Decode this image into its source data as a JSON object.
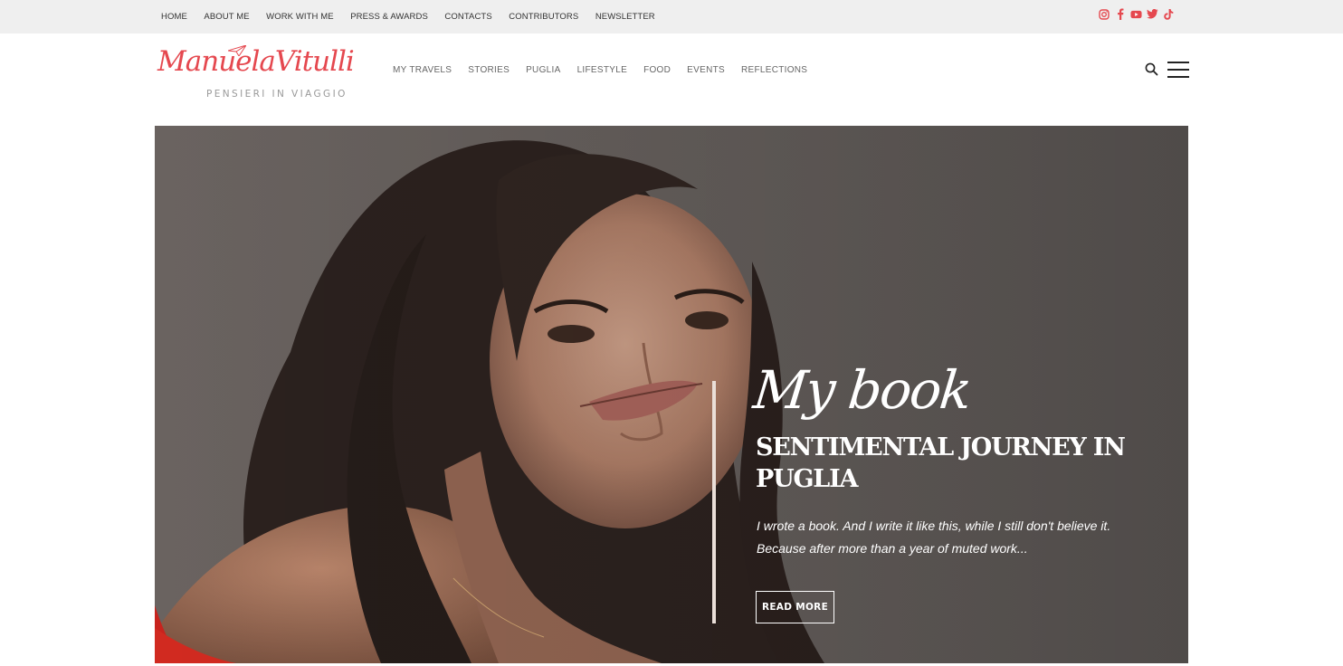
{
  "topnav": {
    "items": [
      "HOME",
      "ABOUT ME",
      "WORK WITH ME",
      "PRESS & AWARDS",
      "CONTACTS",
      "CONTRIBUTORS",
      "NEWSLETTER"
    ]
  },
  "social": {
    "icons": [
      "instagram-icon",
      "facebook-icon",
      "youtube-icon",
      "twitter-icon",
      "tiktok-icon"
    ],
    "color": "#e5484f"
  },
  "logo": {
    "name": "ManuelaVitulli",
    "tagline": "PENSIERI IN VIAGGIO",
    "color": "#e5484f"
  },
  "mainnav": {
    "items": [
      "MY TRAVELS",
      "STORIES",
      "PUGLIA",
      "LIFESTYLE",
      "FOOD",
      "EVENTS",
      "REFLECTIONS"
    ]
  },
  "header_icons": [
    "search-icon",
    "hamburger-menu-icon"
  ],
  "hero": {
    "script_heading": "My book",
    "title": "SENTIMENTAL JOURNEY IN PUGLIA",
    "excerpt": "I wrote a book. And I write it like this, while I still don't believe it. Because after more than a year of muted work...",
    "button_label": "READ MORE"
  }
}
